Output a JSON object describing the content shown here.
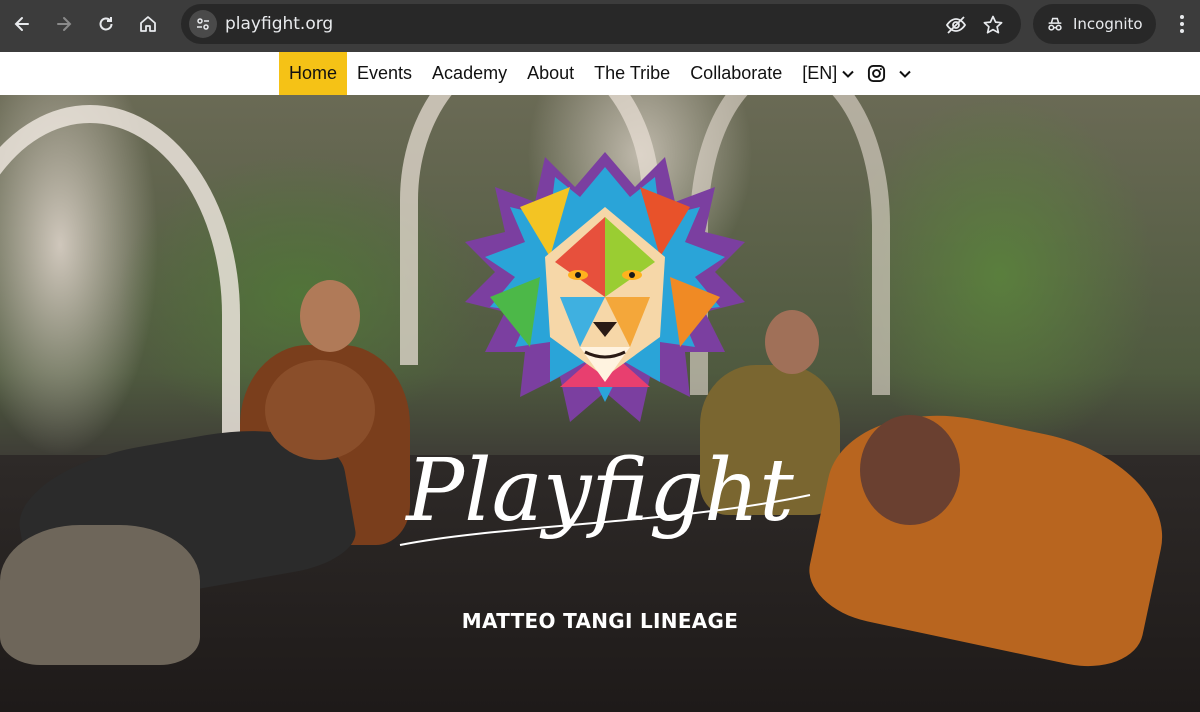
{
  "browser": {
    "url": "playfight.org",
    "incognito_label": "Incognito"
  },
  "site_nav": {
    "items": [
      {
        "label": "Home",
        "active": true
      },
      {
        "label": "Events"
      },
      {
        "label": "Academy"
      },
      {
        "label": "About"
      },
      {
        "label": "The Tribe"
      },
      {
        "label": "Collaborate"
      }
    ],
    "language": "[EN]",
    "social_icon": "instagram-icon",
    "active_color": "#f5c216"
  },
  "hero": {
    "logo_icon": "lion-logo",
    "script_title": "Playfight",
    "tagline": "MATTEO TANGI LINEAGE"
  }
}
